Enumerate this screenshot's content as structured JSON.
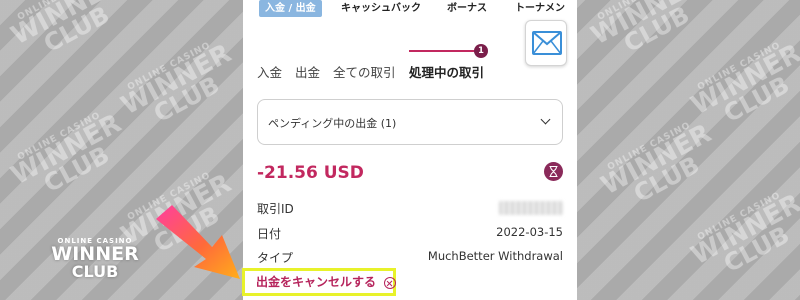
{
  "top_tabs": [
    {
      "label": "入金 / 出金",
      "active": true
    },
    {
      "label": "キャッシュバック",
      "active": false
    },
    {
      "label": "ボーナス",
      "active": false
    },
    {
      "label": "トーナメン",
      "active": false
    }
  ],
  "sub_tabs": [
    {
      "label": "入金"
    },
    {
      "label": "出金"
    },
    {
      "label": "全ての取引"
    },
    {
      "label": "処理中の取引",
      "active": true
    }
  ],
  "pending_count": "1",
  "dropdown": {
    "selected": "ペンディング中の出金 (1)"
  },
  "transaction": {
    "amount": "-21.56 USD",
    "id_label": "取引ID",
    "date_label": "日付",
    "date_value": "2022-03-15",
    "type_label": "タイプ",
    "type_value": "MuchBetter Withdrawal"
  },
  "cancel_label": "出金をキャンセルする",
  "icons": {
    "mail": "mail-icon",
    "hourglass": "hourglass-icon",
    "cancel": "close-circle-icon",
    "chevron": "chevron-down-icon",
    "arrow": "arrow-pointer"
  },
  "watermark": {
    "line1": "ONLINE CASINO",
    "line2": "WINNER",
    "line3": "CLUB"
  },
  "colors": {
    "accent": "#c2285f",
    "highlight": "#e8f22a",
    "tab_active": "#8ab6e0"
  }
}
